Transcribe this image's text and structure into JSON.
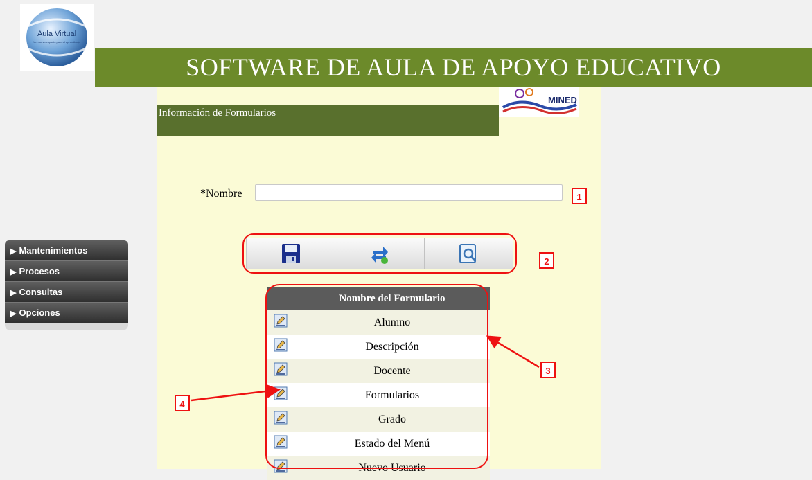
{
  "header": {
    "logo_text": "Aula Virtual",
    "logo_tagline": "Un nuevo espacio para el aprendizaje",
    "banner_title": "SOFTWARE DE AULA DE APOYO EDUCATIVO",
    "mined_logo_text": "MINED"
  },
  "form": {
    "section_title": "Información de Formularios",
    "name_label": "*Nombre",
    "name_value": ""
  },
  "toolbar": {
    "buttons": [
      {
        "icon": "save-icon"
      },
      {
        "icon": "refresh-icon"
      },
      {
        "icon": "search-icon"
      }
    ]
  },
  "table": {
    "header": "Nombre del Formulario",
    "rows": [
      "Alumno",
      "Descripción",
      "Docente",
      "Formularios",
      "Grado",
      "Estado del Menú",
      "Nuevo Usuario"
    ]
  },
  "sidebar": {
    "items": [
      {
        "label": "Mantenimientos"
      },
      {
        "label": "Procesos"
      },
      {
        "label": "Consultas"
      },
      {
        "label": "Opciones"
      }
    ]
  },
  "callouts": [
    "1",
    "2",
    "3",
    "4"
  ],
  "colors": {
    "banner": "#6c8a2a",
    "section": "#59702d",
    "content_bg": "#fbfbd6",
    "annotation": "#e11111"
  }
}
